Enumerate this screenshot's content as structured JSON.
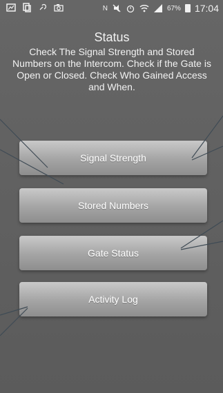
{
  "status_bar": {
    "battery_percent": "67%",
    "time": "17:04",
    "nfc_label": "N"
  },
  "header": {
    "title": "Status",
    "subtitle": "Check The Signal Strength and Stored Numbers on the Intercom. Check if the Gate is Open or Closed. Check Who Gained Access and When."
  },
  "buttons": {
    "signal_strength": "Signal Strength",
    "stored_numbers": "Stored Numbers",
    "gate_status": "Gate Status",
    "activity_log": "Activity Log"
  }
}
